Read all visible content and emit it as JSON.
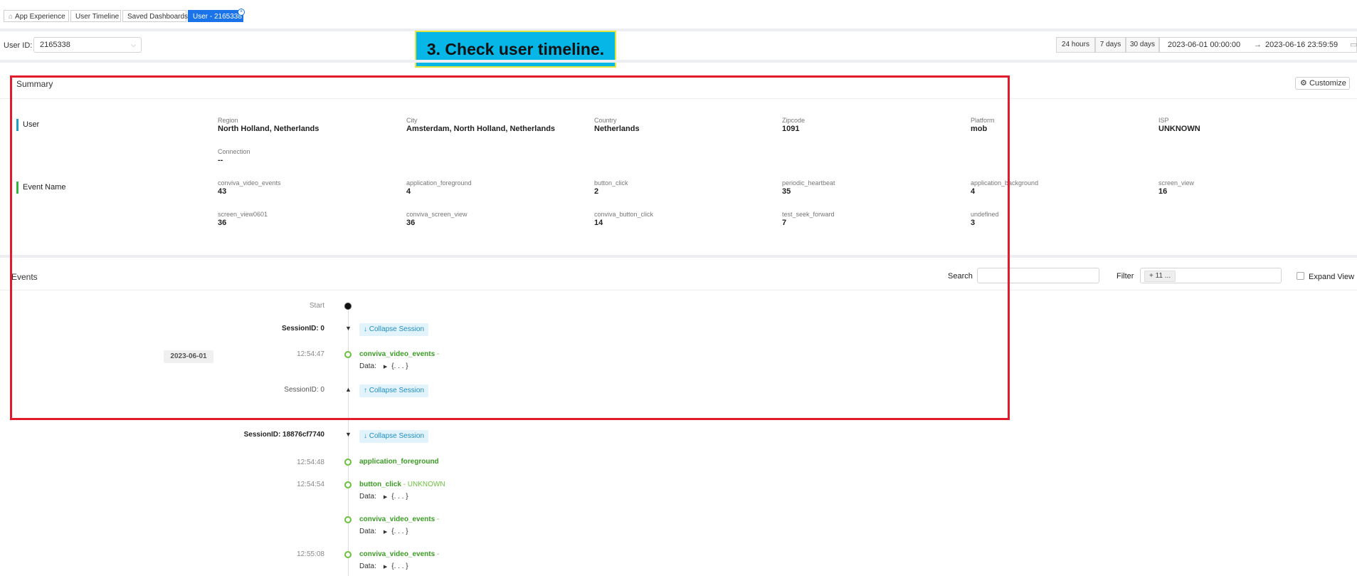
{
  "tabs": [
    {
      "label": "App Experience",
      "icon": "home-icon"
    },
    {
      "label": "User Timeline"
    },
    {
      "label": "Saved Dashboards"
    },
    {
      "label": "User - 2165338",
      "active": true
    }
  ],
  "toolbar": {
    "user_id_label": "User ID:",
    "user_id_value": "2165338",
    "ranges": [
      "24 hours",
      "7 days",
      "30 days"
    ],
    "date_from": "2023-06-01 00:00:00",
    "date_to": "2023-06-16 23:59:59"
  },
  "callout": "3. Check user timeline.",
  "summary": {
    "title": "Summary",
    "customize_label": "Customize",
    "user_group_label": "User",
    "user_fields": [
      {
        "k": "Region",
        "v": "North Holland, Netherlands"
      },
      {
        "k": "City",
        "v": "Amsterdam, North Holland, Netherlands"
      },
      {
        "k": "Country",
        "v": "Netherlands"
      },
      {
        "k": "Zipcode",
        "v": "1091"
      },
      {
        "k": "Platform",
        "v": "mob"
      },
      {
        "k": "ISP",
        "v": "UNKNOWN"
      },
      {
        "k": "Connection",
        "v": "--"
      }
    ],
    "event_group_label": "Event Name",
    "event_fields": [
      {
        "k": "conviva_video_events",
        "v": "43"
      },
      {
        "k": "application_foreground",
        "v": "4"
      },
      {
        "k": "button_click",
        "v": "2"
      },
      {
        "k": "periodic_heartbeat",
        "v": "35"
      },
      {
        "k": "application_background",
        "v": "4"
      },
      {
        "k": "screen_view",
        "v": "16"
      },
      {
        "k": "screen_view0601",
        "v": "36"
      },
      {
        "k": "conviva_screen_view",
        "v": "36"
      },
      {
        "k": "conviva_button_click",
        "v": "14"
      },
      {
        "k": "test_seek_forward",
        "v": "7"
      },
      {
        "k": "undefined",
        "v": "3"
      }
    ]
  },
  "events": {
    "title": "Events",
    "search_label": "Search",
    "filter_label": "Filter",
    "filter_chip": "+ 11 ...",
    "expand_view_label": "Expand View",
    "start_label": "Start",
    "date_badge": "2023-06-01",
    "data_label": "Data:",
    "data_value": "{. . . }",
    "session1_label": "SessionID: 0",
    "session2_label": "SessionID: 18876cf7740",
    "collapse_down": "↓ Collapse Session",
    "collapse_up": "↑ Collapse Session",
    "rows": [
      {
        "time": "12:54:47",
        "name": "conviva_video_events",
        "suffix": " -"
      },
      {
        "time": "12:54:48",
        "name": "application_foreground",
        "suffix": ""
      },
      {
        "time": "12:54:54",
        "name": "button_click",
        "suffix": " - UNKNOWN"
      },
      {
        "time": "",
        "name": "conviva_video_events",
        "suffix": " -"
      },
      {
        "time": "12:55:08",
        "name": "conviva_video_events",
        "suffix": " -"
      }
    ]
  }
}
